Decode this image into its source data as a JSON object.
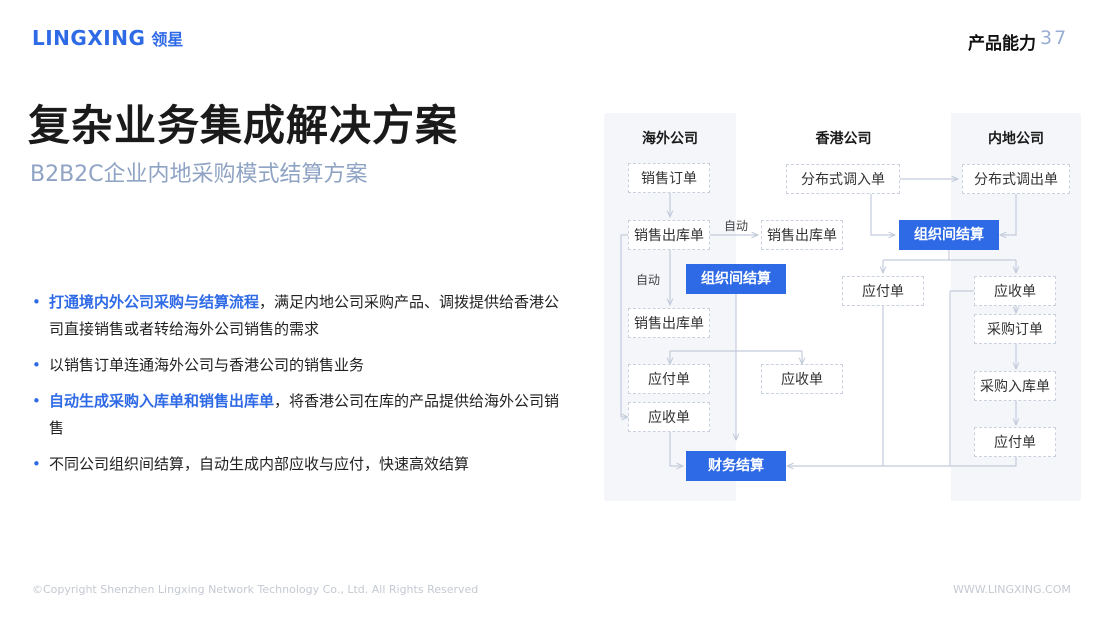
{
  "header": {
    "logo_text": "LINGXING",
    "logo_cn": "领星",
    "section": "产品能力",
    "page_number": "37"
  },
  "title": "复杂业务集成解决方案",
  "subtitle": "B2B2C企业内地采购模式结算方案",
  "bullets": [
    {
      "highlight": "打通境内外公司采购与结算流程",
      "text": "，满足内地公司采购产品、调拨提供给香港公司直接销售或者转给海外公司销售的需求"
    },
    {
      "highlight": "",
      "text": "以销售订单连通海外公司与香港公司的销售业务"
    },
    {
      "highlight": "自动生成采购入库单和销售出库单",
      "text": "，将香港公司在库的产品提供给海外公司销售"
    },
    {
      "highlight": "",
      "text": "不同公司组织间结算，自动生成内部应收与应付，快速高效结算"
    }
  ],
  "diagram": {
    "columns": [
      "海外公司",
      "香港公司",
      "内地公司"
    ],
    "nodes": {
      "overseas_sales_order": "销售订单",
      "overseas_outbound": "销售出库单",
      "overseas_org_settle": "组织间结算",
      "overseas_outbound_2": "销售出库单",
      "overseas_payable": "应付单",
      "overseas_receivable": "应收单",
      "finance_settle": "财务结算",
      "hk_transfer_in": "分布式调入单",
      "hk_outbound": "销售出库单",
      "hk_org_settle": "组织间结算",
      "hk_payable": "应付单",
      "hk_receivable": "应收单",
      "cn_transfer_out": "分布式调出单",
      "cn_receivable": "应收单",
      "cn_purchase_order": "采购订单",
      "cn_purchase_inbound": "采购入库单",
      "cn_payable": "应付单"
    },
    "edge_labels": {
      "auto_1": "自动",
      "auto_2": "自动"
    }
  },
  "footer": {
    "copyright": "©Copyright Shenzhen Lingxing Network Technology Co., Ltd. All Rights Reserved",
    "website": "WWW.LINGXING.COM"
  },
  "colors": {
    "brand_blue": "#2f6ae6",
    "subtitle": "#8fa3c4",
    "arrow": "#c3cbdb"
  }
}
